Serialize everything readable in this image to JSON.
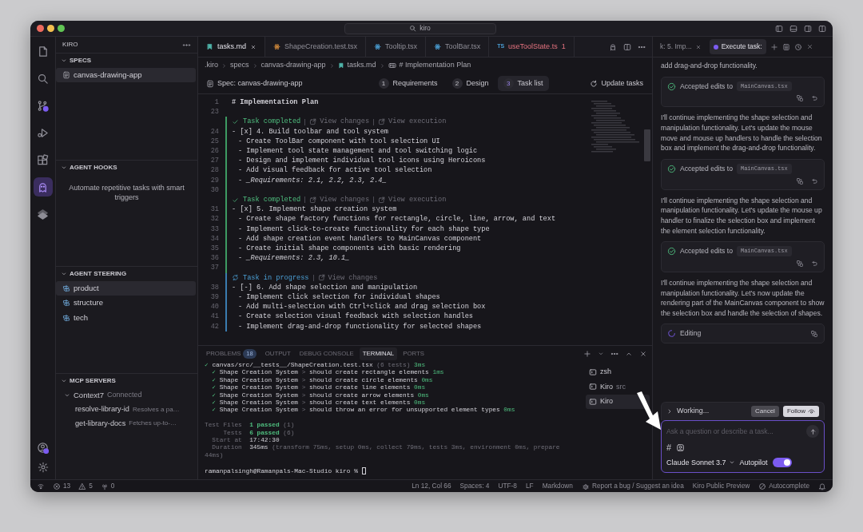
{
  "title_bar": {
    "search": "kiro"
  },
  "activity_bar": {
    "items": [
      {
        "selected": false
      },
      {
        "selected": false
      },
      {
        "selected": false
      },
      {
        "selected": false
      },
      {
        "selected": false
      },
      {
        "selected": true
      },
      {
        "selected": false
      }
    ]
  },
  "sidebar": {
    "title": "KIRO",
    "sections": [
      {
        "kind": "list",
        "title": "SPECS",
        "items": [
          {
            "label": "canvas-drawing-app",
            "kind": "spec",
            "selected": true
          }
        ]
      },
      {
        "kind": "hint",
        "title": "AGENT HOOKS",
        "hint": "Automate repetitive tasks with smart triggers"
      },
      {
        "kind": "list",
        "title": "AGENT STEERING",
        "items": [
          {
            "label": "product",
            "kind": "steering",
            "selected": true
          },
          {
            "label": "structure",
            "kind": "steering",
            "selected": false
          },
          {
            "label": "tech",
            "kind": "steering",
            "selected": false
          }
        ]
      },
      {
        "kind": "servers",
        "title": "MCP SERVERS",
        "servers": [
          {
            "name": "Context7",
            "status": "Connected",
            "expanded": true,
            "tools": [
              {
                "name": "resolve-library-id",
                "description": "Resolves a pa…"
              },
              {
                "name": "get-library-docs",
                "description": "Fetches up-to-…"
              }
            ]
          }
        ]
      }
    ]
  },
  "editor": {
    "tabs": [
      {
        "label": "tasks.md",
        "kind": "md",
        "selected": true
      },
      {
        "label": "ShapeCreation.test.tsx",
        "kind": "test",
        "selected": false
      },
      {
        "label": "Tooltip.tsx",
        "kind": "tsx",
        "selected": false
      },
      {
        "label": "ToolBar.tsx",
        "kind": "tsx",
        "selected": false
      },
      {
        "label": "useToolState.ts",
        "kind": "ts",
        "badge": "TS",
        "problems": "1",
        "selected": false
      }
    ],
    "breadcrumb": [
      {
        "label": ".kiro",
        "kind": "folder"
      },
      {
        "label": "specs",
        "kind": "folder"
      },
      {
        "label": "canvas-drawing-app",
        "kind": "folder"
      },
      {
        "label": "tasks.md",
        "kind": "file"
      },
      {
        "label": "# Implementation Plan",
        "kind": "symbol"
      }
    ],
    "spec_bar": {
      "title": "Spec: canvas-drawing-app",
      "steps": [
        {
          "number": "1",
          "label": "Requirements",
          "selected": false
        },
        {
          "number": "2",
          "label": "Design",
          "selected": false
        },
        {
          "number": "3",
          "label": "Task list",
          "selected": true
        }
      ],
      "action": "Update tasks"
    },
    "blocks": [
      {
        "kind": "plain",
        "lines": [
          {
            "num": "1",
            "kind": "heading",
            "text": "# Implementation Plan"
          },
          {
            "num": "23",
            "kind": "blank"
          }
        ]
      },
      {
        "kind": "completed",
        "label": "Task completed",
        "actions": [
          "View changes",
          "View execution"
        ],
        "lines": [
          {
            "num": "24",
            "kind": "task",
            "text": "- [x] 4. Build toolbar and tool system"
          },
          {
            "num": "25",
            "kind": "sub",
            "text": "- Create ToolBar component with tool selection UI"
          },
          {
            "num": "26",
            "kind": "sub",
            "text": "- Implement tool state management and tool switching logic"
          },
          {
            "num": "27",
            "kind": "sub",
            "text": "- Design and implement individual tool icons using Heroicons"
          },
          {
            "num": "28",
            "kind": "sub",
            "text": "- Add visual feedback for active tool selection"
          },
          {
            "num": "29",
            "kind": "sub",
            "text": "- *_Requirements: 2.1, 2.2, 2.3, 2.4_*"
          },
          {
            "num": "30",
            "kind": "blank"
          }
        ]
      },
      {
        "kind": "completed",
        "label": "Task completed",
        "actions": [
          "View changes",
          "View execution"
        ],
        "lines": [
          {
            "num": "31",
            "kind": "task",
            "text": "- [x] 5. Implement shape creation system"
          },
          {
            "num": "32",
            "kind": "sub",
            "text": "- Create shape factory functions for rectangle, circle, line, arrow, and text"
          },
          {
            "num": "33",
            "kind": "sub",
            "text": "- Implement click-to-create functionality for each shape type"
          },
          {
            "num": "34",
            "kind": "sub",
            "text": "- Add shape creation event handlers to MainCanvas component"
          },
          {
            "num": "35",
            "kind": "sub",
            "text": "- Create initial shape components with basic rendering"
          },
          {
            "num": "36",
            "kind": "sub",
            "text": "- *_Requirements: 2.3, 10.1_*"
          },
          {
            "num": "37",
            "kind": "blank"
          }
        ]
      },
      {
        "kind": "in_progress",
        "label": "Task in progress",
        "actions": [
          "View changes"
        ],
        "lines": [
          {
            "num": "38",
            "kind": "task",
            "text": "- [-] 6. Add shape selection and manipulation"
          },
          {
            "num": "39",
            "kind": "sub",
            "text": "- Implement click selection for individual shapes"
          },
          {
            "num": "40",
            "kind": "sub",
            "text": "- Add multi-selection with Ctrl+click and drag selection box"
          },
          {
            "num": "41",
            "kind": "sub",
            "text": "- Create selection visual feedback with selection handles"
          },
          {
            "num": "42",
            "kind": "sub",
            "text": "- Implement drag-and-drop functionality for selected shapes"
          }
        ]
      }
    ]
  },
  "panel": {
    "tabs": [
      {
        "label": "PROBLEMS",
        "count": "18",
        "selected": false
      },
      {
        "label": "OUTPUT",
        "selected": false
      },
      {
        "label": "DEBUG CONSOLE",
        "selected": false
      },
      {
        "label": "TERMINAL",
        "selected": true
      },
      {
        "label": "PORTS",
        "selected": false
      }
    ],
    "terminal": [
      {
        "kind": "output",
        "segments": [
          {
            "t": "✓",
            "kind": "green"
          },
          {
            "t": " canvas/src/__tests__/ShapeCreation.test.tsx ",
            "kind": "normal"
          },
          {
            "t": "(6 tests)",
            "kind": "dim"
          },
          {
            "t": " 3ms",
            "kind": "green"
          }
        ]
      },
      {
        "kind": "output",
        "segments": [
          {
            "t": "  ✓",
            "kind": "green"
          },
          {
            "t": " Shape Creation System",
            "kind": "normal"
          },
          {
            "t": " > ",
            "kind": "dim"
          },
          {
            "t": "should create rectangle elements ",
            "kind": "normal"
          },
          {
            "t": "1ms",
            "kind": "green"
          }
        ]
      },
      {
        "kind": "output",
        "segments": [
          {
            "t": "  ✓",
            "kind": "green"
          },
          {
            "t": " Shape Creation System",
            "kind": "normal"
          },
          {
            "t": " > ",
            "kind": "dim"
          },
          {
            "t": "should create circle elements ",
            "kind": "normal"
          },
          {
            "t": "0ms",
            "kind": "green"
          }
        ]
      },
      {
        "kind": "output",
        "segments": [
          {
            "t": "  ✓",
            "kind": "green"
          },
          {
            "t": " Shape Creation System",
            "kind": "normal"
          },
          {
            "t": " > ",
            "kind": "dim"
          },
          {
            "t": "should create line elements ",
            "kind": "normal"
          },
          {
            "t": "0ms",
            "kind": "green"
          }
        ]
      },
      {
        "kind": "output",
        "segments": [
          {
            "t": "  ✓",
            "kind": "green"
          },
          {
            "t": " Shape Creation System",
            "kind": "normal"
          },
          {
            "t": " > ",
            "kind": "dim"
          },
          {
            "t": "should create arrow elements ",
            "kind": "normal"
          },
          {
            "t": "0ms",
            "kind": "green"
          }
        ]
      },
      {
        "kind": "output",
        "segments": [
          {
            "t": "  ✓",
            "kind": "green"
          },
          {
            "t": " Shape Creation System",
            "kind": "normal"
          },
          {
            "t": " > ",
            "kind": "dim"
          },
          {
            "t": "should create text elements ",
            "kind": "normal"
          },
          {
            "t": "0ms",
            "kind": "green"
          }
        ]
      },
      {
        "kind": "output",
        "segments": [
          {
            "t": "  ✓",
            "kind": "green"
          },
          {
            "t": " Shape Creation System",
            "kind": "normal"
          },
          {
            "t": " > ",
            "kind": "dim"
          },
          {
            "t": "should throw an error for unsupported element types ",
            "kind": "normal"
          },
          {
            "t": "0ms",
            "kind": "green"
          }
        ]
      },
      {
        "kind": "blank"
      },
      {
        "kind": "output",
        "segments": [
          {
            "t": "Test Files  ",
            "kind": "dim"
          },
          {
            "t": "1 passed",
            "kind": "pass"
          },
          {
            "t": " (1)",
            "kind": "dim"
          }
        ]
      },
      {
        "kind": "output",
        "segments": [
          {
            "t": "     Tests  ",
            "kind": "dim"
          },
          {
            "t": "6 passed",
            "kind": "pass"
          },
          {
            "t": " (6)",
            "kind": "dim"
          }
        ]
      },
      {
        "kind": "output",
        "segments": [
          {
            "t": "  Start at  ",
            "kind": "dim"
          },
          {
            "t": "17:42:30",
            "kind": "normal"
          }
        ]
      },
      {
        "kind": "output",
        "segments": [
          {
            "t": "  Duration  ",
            "kind": "dim"
          },
          {
            "t": "345ms",
            "kind": "normal"
          },
          {
            "t": " (transform 75ms, setup 0ms, collect 79ms, tests 3ms, environment 0ms, prepare",
            "kind": "dim"
          }
        ]
      },
      {
        "kind": "output",
        "segments": [
          {
            "t": "44ms)",
            "kind": "dim"
          }
        ]
      },
      {
        "kind": "blank"
      },
      {
        "kind": "prompt",
        "segments": [
          {
            "t": "ramanpalsingh@Ramanpals-Mac-Studio kiro % ",
            "kind": "normal"
          }
        ]
      }
    ],
    "terminals": [
      {
        "label": "zsh",
        "selected": false
      },
      {
        "label": "Kiro",
        "detail": "src",
        "selected": false
      },
      {
        "label": "Kiro",
        "selected": true
      }
    ]
  },
  "chat": {
    "tabs": [
      {
        "label": "k: 5. Imp...",
        "selected": false
      },
      {
        "label": "Execute task:",
        "selected": true
      }
    ],
    "messages": [
      {
        "kind": "text",
        "text": "add drag-and-drop functionality."
      },
      {
        "kind": "edit",
        "label": "Accepted edits to",
        "file": "MainCanvas.tsx"
      },
      {
        "kind": "text",
        "text": "I'll continue implementing the shape selection and manipulation functionality. Let's update the mouse move and mouse up handlers to handle the selection box and implement the drag-and-drop functionality."
      },
      {
        "kind": "edit",
        "label": "Accepted edits to",
        "file": "MainCanvas.tsx"
      },
      {
        "kind": "text",
        "text": "I'll continue implementing the shape selection and manipulation functionality. Let's update the mouse up handler to finalize the selection box and implement the element selection functionality."
      },
      {
        "kind": "edit",
        "label": "Accepted edits to",
        "file": "MainCanvas.tsx"
      },
      {
        "kind": "text",
        "text": "I'll continue implementing the shape selection and manipulation functionality. Let's now update the rendering part of the MainCanvas component to show the selection box and handle the selection of shapes."
      },
      {
        "kind": "editing",
        "label": "Editing"
      }
    ],
    "working": {
      "label": "Working...",
      "cancel": "Cancel",
      "follow": "Follow"
    },
    "input": {
      "placeholder": "Ask a question or describe a task...",
      "context": "#",
      "model": "Claude Sonnet 3.7",
      "autopilot_label": "Autopilot",
      "autopilot": true
    }
  },
  "status_bar": {
    "left": [
      {
        "kind": "errors",
        "text": "13"
      },
      {
        "kind": "warnings",
        "text": "5"
      },
      {
        "kind": "ports",
        "text": "0"
      }
    ],
    "right": [
      {
        "kind": "text",
        "text": "Ln 12, Col 66"
      },
      {
        "kind": "text",
        "text": "Spaces: 4"
      },
      {
        "kind": "text",
        "text": "UTF-8"
      },
      {
        "kind": "text",
        "text": "LF"
      },
      {
        "kind": "text",
        "text": "Markdown"
      },
      {
        "kind": "feedback",
        "text": "Report a bug / Suggest an idea"
      },
      {
        "kind": "text",
        "text": "Kiro Public Preview"
      },
      {
        "kind": "autocomplete",
        "text": "Autocomplete"
      },
      {
        "kind": "bell"
      }
    ]
  }
}
